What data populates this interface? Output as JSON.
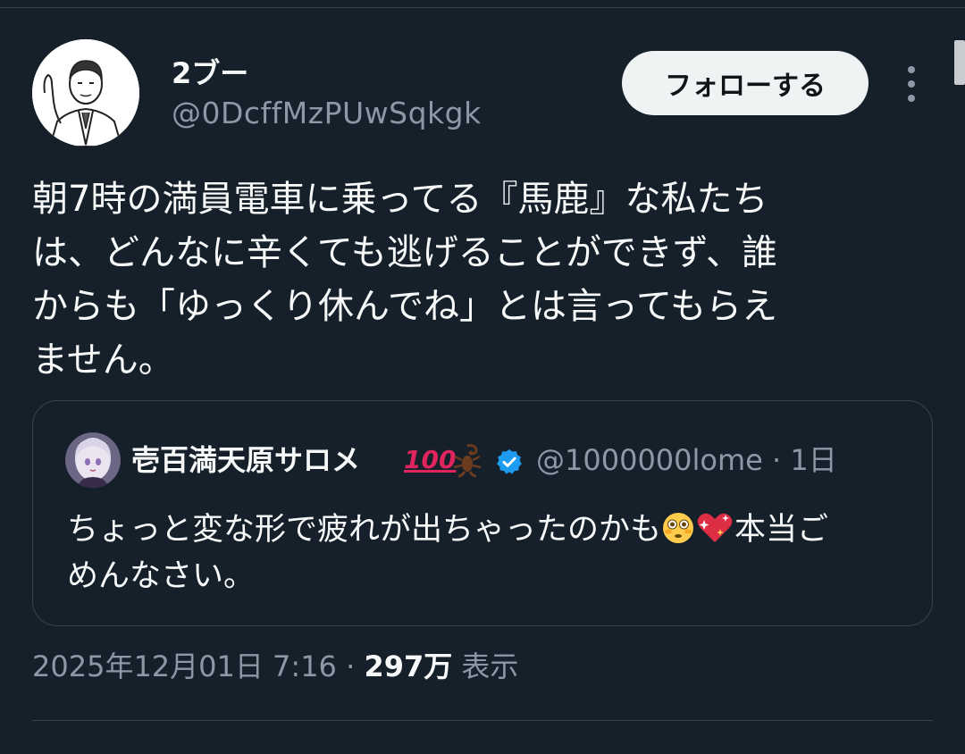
{
  "tweet": {
    "author": {
      "name": "2ブー",
      "handle": "@0DcffMzPUwSqkgk"
    },
    "follow_label": "フォローする",
    "text": "朝7時の満員電車に乗ってる『馬鹿』な私たち\nは、どんなに辛くても逃げることができず、誰\nからも「ゆっくり休んでね」とは言ってもらえ\nません。",
    "quote": {
      "name": "壱百満天原サロメ",
      "name_emoji": "100",
      "handle_time": "@1000000lome · 1日",
      "text_part1": "ちょっと変な形で疲れが出ちゃったのかも",
      "text_part2": "本当ご\nめんなさい。"
    },
    "meta": {
      "datetime": "2025年12月01日 7:16 · ",
      "views_count": "297万",
      "views_label": " 表示"
    }
  },
  "colors": {
    "background": "#15202b",
    "text": "#f7f9f9",
    "secondary_text": "#8b98a5",
    "border": "#38444d",
    "verified": "#1d9bf0"
  },
  "icons": [
    "more-vertical-icon",
    "verified-icon",
    "hundred-points-emoji",
    "scorpion-emoji",
    "flushed-face-emoji",
    "sparkling-heart-emoji"
  ]
}
